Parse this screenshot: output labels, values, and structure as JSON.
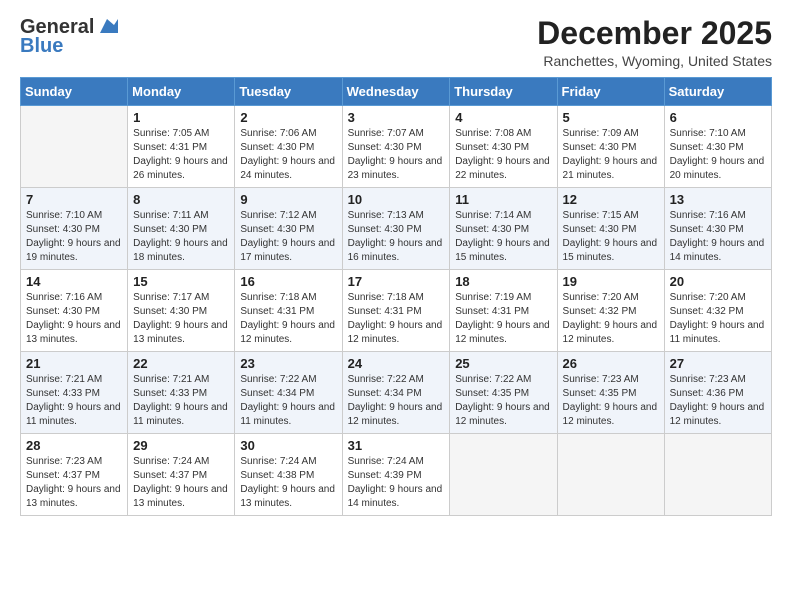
{
  "logo": {
    "general": "General",
    "blue": "Blue"
  },
  "title": "December 2025",
  "subtitle": "Ranchettes, Wyoming, United States",
  "days_of_week": [
    "Sunday",
    "Monday",
    "Tuesday",
    "Wednesday",
    "Thursday",
    "Friday",
    "Saturday"
  ],
  "weeks": [
    [
      {
        "day": "",
        "sunrise": "",
        "sunset": "",
        "daylight": "",
        "empty": true
      },
      {
        "day": "1",
        "sunrise": "Sunrise: 7:05 AM",
        "sunset": "Sunset: 4:31 PM",
        "daylight": "Daylight: 9 hours and 26 minutes."
      },
      {
        "day": "2",
        "sunrise": "Sunrise: 7:06 AM",
        "sunset": "Sunset: 4:30 PM",
        "daylight": "Daylight: 9 hours and 24 minutes."
      },
      {
        "day": "3",
        "sunrise": "Sunrise: 7:07 AM",
        "sunset": "Sunset: 4:30 PM",
        "daylight": "Daylight: 9 hours and 23 minutes."
      },
      {
        "day": "4",
        "sunrise": "Sunrise: 7:08 AM",
        "sunset": "Sunset: 4:30 PM",
        "daylight": "Daylight: 9 hours and 22 minutes."
      },
      {
        "day": "5",
        "sunrise": "Sunrise: 7:09 AM",
        "sunset": "Sunset: 4:30 PM",
        "daylight": "Daylight: 9 hours and 21 minutes."
      },
      {
        "day": "6",
        "sunrise": "Sunrise: 7:10 AM",
        "sunset": "Sunset: 4:30 PM",
        "daylight": "Daylight: 9 hours and 20 minutes."
      }
    ],
    [
      {
        "day": "7",
        "sunrise": "Sunrise: 7:10 AM",
        "sunset": "Sunset: 4:30 PM",
        "daylight": "Daylight: 9 hours and 19 minutes."
      },
      {
        "day": "8",
        "sunrise": "Sunrise: 7:11 AM",
        "sunset": "Sunset: 4:30 PM",
        "daylight": "Daylight: 9 hours and 18 minutes."
      },
      {
        "day": "9",
        "sunrise": "Sunrise: 7:12 AM",
        "sunset": "Sunset: 4:30 PM",
        "daylight": "Daylight: 9 hours and 17 minutes."
      },
      {
        "day": "10",
        "sunrise": "Sunrise: 7:13 AM",
        "sunset": "Sunset: 4:30 PM",
        "daylight": "Daylight: 9 hours and 16 minutes."
      },
      {
        "day": "11",
        "sunrise": "Sunrise: 7:14 AM",
        "sunset": "Sunset: 4:30 PM",
        "daylight": "Daylight: 9 hours and 15 minutes."
      },
      {
        "day": "12",
        "sunrise": "Sunrise: 7:15 AM",
        "sunset": "Sunset: 4:30 PM",
        "daylight": "Daylight: 9 hours and 15 minutes."
      },
      {
        "day": "13",
        "sunrise": "Sunrise: 7:16 AM",
        "sunset": "Sunset: 4:30 PM",
        "daylight": "Daylight: 9 hours and 14 minutes."
      }
    ],
    [
      {
        "day": "14",
        "sunrise": "Sunrise: 7:16 AM",
        "sunset": "Sunset: 4:30 PM",
        "daylight": "Daylight: 9 hours and 13 minutes."
      },
      {
        "day": "15",
        "sunrise": "Sunrise: 7:17 AM",
        "sunset": "Sunset: 4:30 PM",
        "daylight": "Daylight: 9 hours and 13 minutes."
      },
      {
        "day": "16",
        "sunrise": "Sunrise: 7:18 AM",
        "sunset": "Sunset: 4:31 PM",
        "daylight": "Daylight: 9 hours and 12 minutes."
      },
      {
        "day": "17",
        "sunrise": "Sunrise: 7:18 AM",
        "sunset": "Sunset: 4:31 PM",
        "daylight": "Daylight: 9 hours and 12 minutes."
      },
      {
        "day": "18",
        "sunrise": "Sunrise: 7:19 AM",
        "sunset": "Sunset: 4:31 PM",
        "daylight": "Daylight: 9 hours and 12 minutes."
      },
      {
        "day": "19",
        "sunrise": "Sunrise: 7:20 AM",
        "sunset": "Sunset: 4:32 PM",
        "daylight": "Daylight: 9 hours and 12 minutes."
      },
      {
        "day": "20",
        "sunrise": "Sunrise: 7:20 AM",
        "sunset": "Sunset: 4:32 PM",
        "daylight": "Daylight: 9 hours and 11 minutes."
      }
    ],
    [
      {
        "day": "21",
        "sunrise": "Sunrise: 7:21 AM",
        "sunset": "Sunset: 4:33 PM",
        "daylight": "Daylight: 9 hours and 11 minutes."
      },
      {
        "day": "22",
        "sunrise": "Sunrise: 7:21 AM",
        "sunset": "Sunset: 4:33 PM",
        "daylight": "Daylight: 9 hours and 11 minutes."
      },
      {
        "day": "23",
        "sunrise": "Sunrise: 7:22 AM",
        "sunset": "Sunset: 4:34 PM",
        "daylight": "Daylight: 9 hours and 11 minutes."
      },
      {
        "day": "24",
        "sunrise": "Sunrise: 7:22 AM",
        "sunset": "Sunset: 4:34 PM",
        "daylight": "Daylight: 9 hours and 12 minutes."
      },
      {
        "day": "25",
        "sunrise": "Sunrise: 7:22 AM",
        "sunset": "Sunset: 4:35 PM",
        "daylight": "Daylight: 9 hours and 12 minutes."
      },
      {
        "day": "26",
        "sunrise": "Sunrise: 7:23 AM",
        "sunset": "Sunset: 4:35 PM",
        "daylight": "Daylight: 9 hours and 12 minutes."
      },
      {
        "day": "27",
        "sunrise": "Sunrise: 7:23 AM",
        "sunset": "Sunset: 4:36 PM",
        "daylight": "Daylight: 9 hours and 12 minutes."
      }
    ],
    [
      {
        "day": "28",
        "sunrise": "Sunrise: 7:23 AM",
        "sunset": "Sunset: 4:37 PM",
        "daylight": "Daylight: 9 hours and 13 minutes."
      },
      {
        "day": "29",
        "sunrise": "Sunrise: 7:24 AM",
        "sunset": "Sunset: 4:37 PM",
        "daylight": "Daylight: 9 hours and 13 minutes."
      },
      {
        "day": "30",
        "sunrise": "Sunrise: 7:24 AM",
        "sunset": "Sunset: 4:38 PM",
        "daylight": "Daylight: 9 hours and 13 minutes."
      },
      {
        "day": "31",
        "sunrise": "Sunrise: 7:24 AM",
        "sunset": "Sunset: 4:39 PM",
        "daylight": "Daylight: 9 hours and 14 minutes."
      },
      {
        "day": "",
        "sunrise": "",
        "sunset": "",
        "daylight": "",
        "empty": true
      },
      {
        "day": "",
        "sunrise": "",
        "sunset": "",
        "daylight": "",
        "empty": true
      },
      {
        "day": "",
        "sunrise": "",
        "sunset": "",
        "daylight": "",
        "empty": true
      }
    ]
  ]
}
